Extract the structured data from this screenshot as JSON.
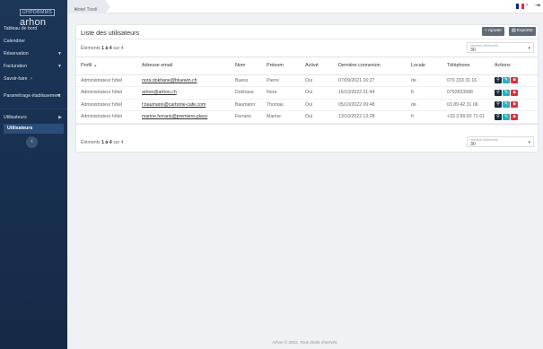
{
  "brand": {
    "top": "UHPDBMMS",
    "main": "arhon"
  },
  "sidebar": {
    "items": [
      {
        "label": "Tableau de bord"
      },
      {
        "label": "Calendrier"
      },
      {
        "label": "Réservation",
        "chevron": "chevron-down-icon"
      },
      {
        "label": "Facturation",
        "chevron": "chevron-down-icon"
      },
      {
        "label": "Savoir-faire",
        "icon": "external-link-icon"
      },
      {
        "label": "Paramétrage établissement",
        "chevron": "chevron-down-icon"
      },
      {
        "label": "Utilisateurs",
        "chevron": "chevron-right-icon"
      },
      {
        "label": "Utilisateurs"
      }
    ],
    "collapse_glyph": "‹"
  },
  "topbar": {
    "hotel": "Hotel Tivoli",
    "language": "fr",
    "flag_colors": [
      "#002395",
      "#ffffff",
      "#ed2939"
    ]
  },
  "page": {
    "title": "Liste des utilisateurs",
    "add_label": "+ Ajouter",
    "export_label": "Exporter",
    "count": {
      "prefix": "Éléments ",
      "range": "1 à 4",
      "suffix": " sur 4"
    },
    "rows_per_page_label": "Nombre d'éléments",
    "rows_per_page": "30"
  },
  "table": {
    "columns": [
      "Profil",
      "Adresse email",
      "Nom",
      "Prénom",
      "Activé",
      "Dernière connexion",
      "Locale",
      "Téléphone",
      "Actions"
    ],
    "rows": [
      {
        "profil": "Administrateur hôtel",
        "email": "nora.dokhane@bluewin.ch",
        "nom": "Buess",
        "prenom": "Pierre",
        "active": "Oui",
        "last_login": "07/09/2021 16:27",
        "locale": "de",
        "phone": "079 333 31 16"
      },
      {
        "profil": "Administrateur hôtel",
        "email": "arhon@arhon.ch",
        "nom": "Dokhane",
        "prenom": "Nora",
        "active": "Oui",
        "last_login": "16/10/2022 21:44",
        "locale": "fr",
        "phone": "0792833688"
      },
      {
        "profil": "Administrateur hôtel",
        "email": "f.baumann@carbone-cafe.com",
        "nom": "Baumann",
        "prenom": "Thomas",
        "active": "Oui",
        "last_login": "05/10/2022 09:48",
        "locale": "de",
        "phone": "03 89 42 31 06"
      },
      {
        "profil": "Administrateur hôtel",
        "email": "marine.ferraris@premiere-place",
        "nom": "Ferraris",
        "prenom": "Marine",
        "active": "Oui",
        "last_login": "13/10/2022 13:28",
        "locale": "fr",
        "phone": "+33 3 89 60 71 61"
      }
    ],
    "action_colors": {
      "view": "#1d2a3b",
      "edit": "#26b2c2",
      "delete": "#d9333f"
    }
  },
  "footer": "Arhon © 2022. Tous droits réservés."
}
